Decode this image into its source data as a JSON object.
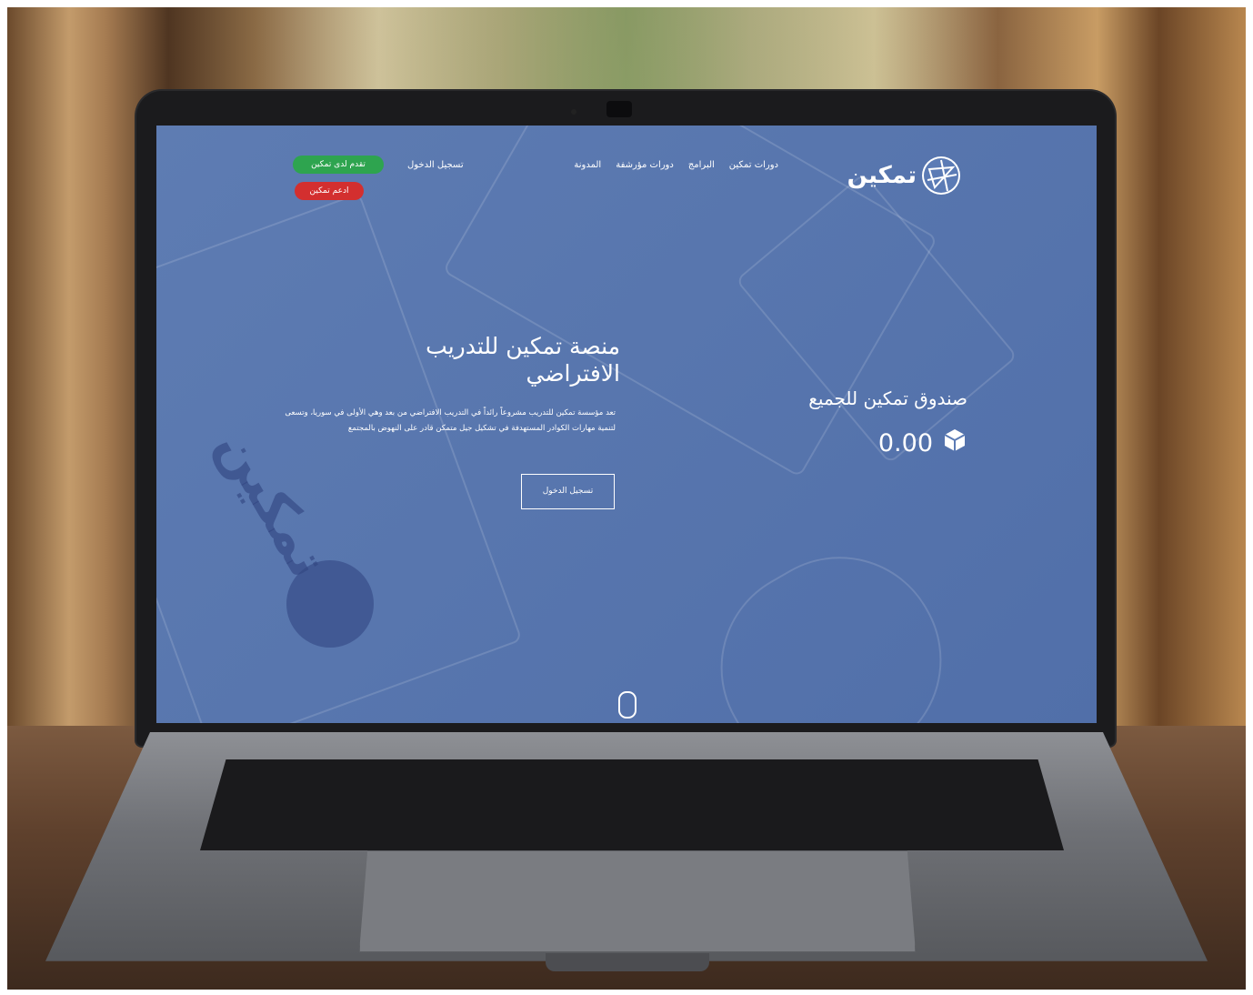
{
  "nav": {
    "logo_text": "تمكين",
    "links": [
      "دورات تمكين",
      "البرامج",
      "دورات مؤرشفة",
      "المدونة"
    ],
    "login_label": "تسجيل الدخول",
    "support_label": "تقدم لدى تمكين",
    "donate_label": "ادعم تمكين"
  },
  "hero": {
    "title": "منصة تمكين للتدريب الافتراضي",
    "description": "تعد مؤسسة تمكين للتدريب مشروعاً رائداً في التدريب الافتراضي من بعد وهي الأولى في سوريا، وتسعى لتنمية مهارات الكوادر المستهدفة في تشكيل جيل متمكن قادر على النهوض بالمجتمع",
    "cta_label": "تسجيل الدخول"
  },
  "fund": {
    "title": "صندوق تمكين للجميع",
    "value": "0.00"
  },
  "colors": {
    "screen_blue": "#5b7bb5",
    "green_button": "#2ea44f",
    "red_button": "#d32f2f"
  },
  "icons": {
    "cube": "cube-icon",
    "scroll": "mouse-scroll-icon"
  }
}
